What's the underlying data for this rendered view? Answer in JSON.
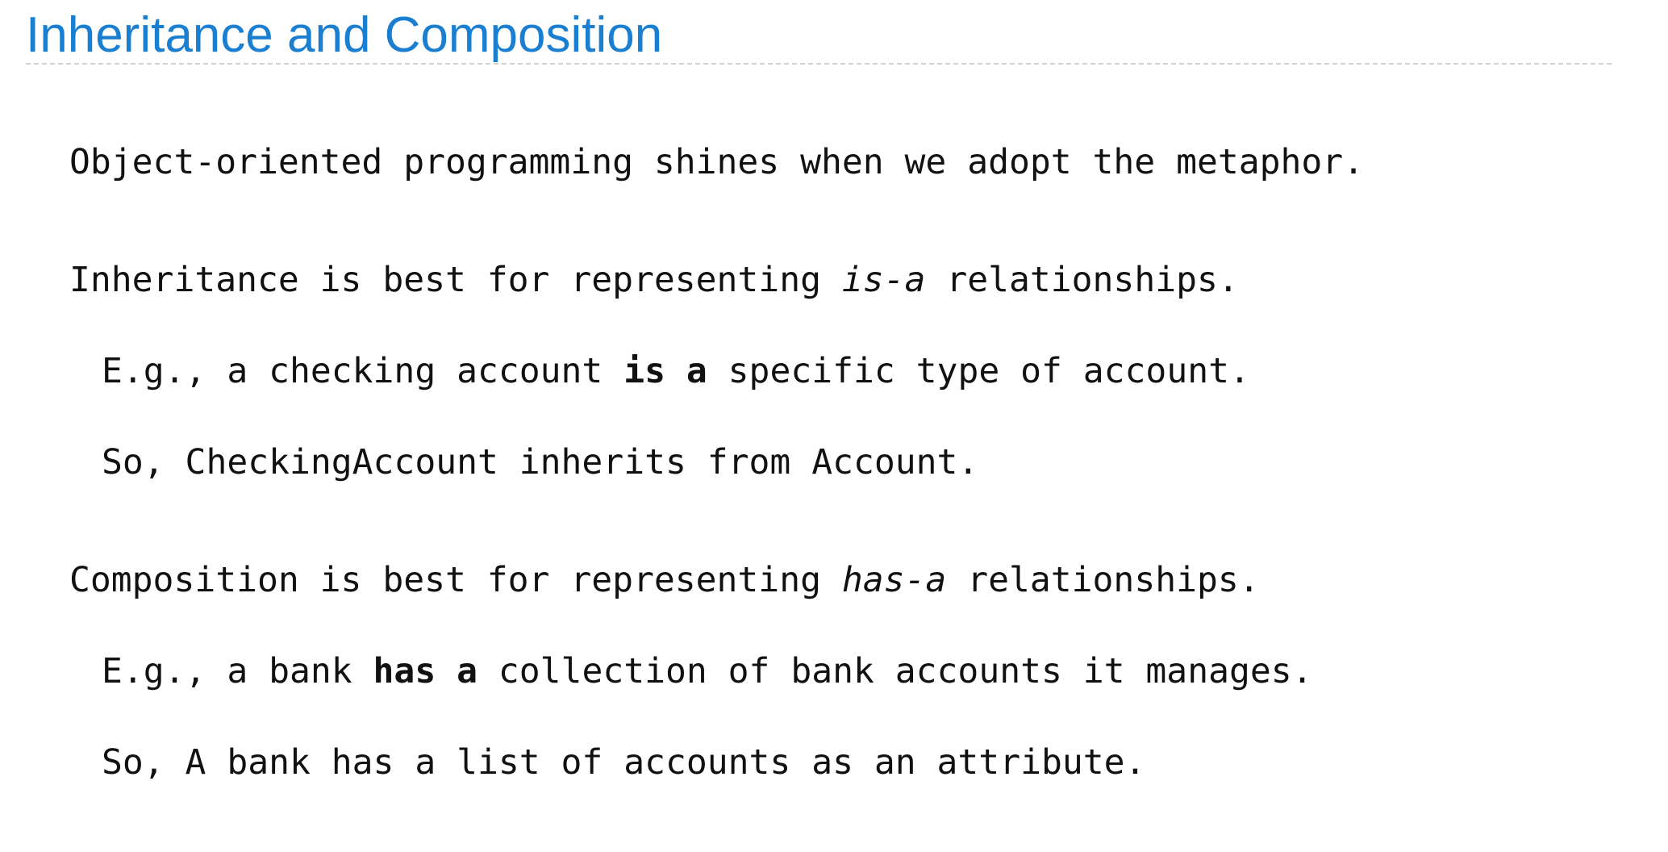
{
  "slide": {
    "title": "Inheritance and Composition",
    "intro": "Object-oriented programming shines when we adopt the metaphor.",
    "inheritance": {
      "lead_before": "Inheritance is best for representing ",
      "lead_em": "is-a",
      "lead_after": " relationships.",
      "example_before": "E.g., a checking account ",
      "example_strong": "is a",
      "example_after": " specific type of account.",
      "conclusion": "So, CheckingAccount inherits from Account."
    },
    "composition": {
      "lead_before": "Composition is best for representing ",
      "lead_em": "has-a",
      "lead_after": " relationships.",
      "example_before": "E.g., a bank ",
      "example_strong": "has a",
      "example_after": " collection of bank accounts it manages.",
      "conclusion": "So, A bank has a list of accounts as an attribute."
    }
  }
}
